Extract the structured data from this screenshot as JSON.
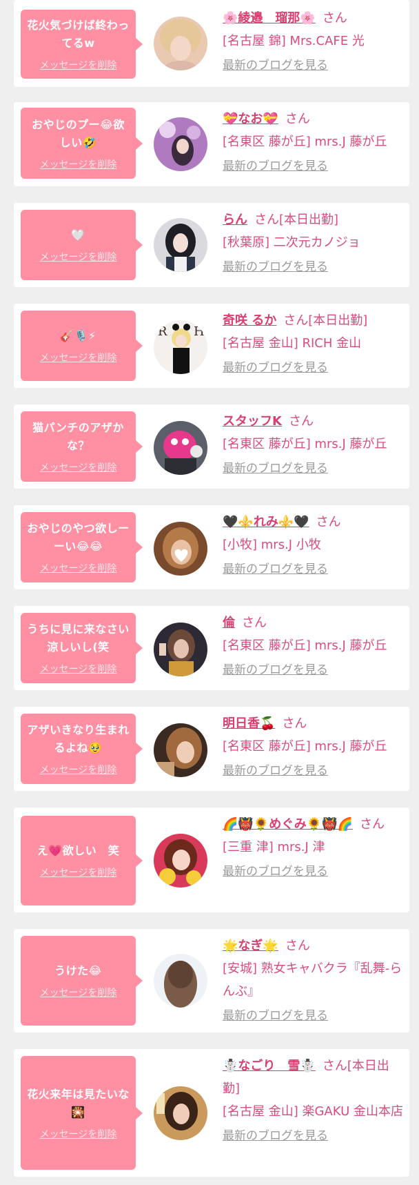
{
  "delete_label": "メッセージを削除",
  "blog_label": "最新のブログを見る",
  "colors": {
    "bubble": "#ff8fa3",
    "accent": "#d84d79",
    "link_gray": "#9a9a9a",
    "background": "#efefef"
  },
  "entries": [
    {
      "message": "花火気づけば終わってるw",
      "name": "🌸綾邉　瑠那🌸",
      "suffix": "さん",
      "status": "",
      "shop": "[名古屋 錦] Mrs.CAFE 光"
    },
    {
      "message": "おやじのプー😂欲しい🤣",
      "name": "💝なお💝",
      "suffix": "さん",
      "status": "",
      "shop": "[名東区 藤が丘] mrs.J 藤が丘"
    },
    {
      "message": "🤍",
      "name": "らん",
      "suffix": "さん",
      "status": "[本日出勤]",
      "shop": "[秋葉原] 二次元カノジョ"
    },
    {
      "message": "🎸🎙️⚡",
      "name": "奇咲 るか",
      "suffix": "さん",
      "status": "[本日出勤]",
      "shop": "[名古屋 金山] RICH 金山"
    },
    {
      "message": "猫パンチのアザかな？",
      "name": "スタッフK",
      "suffix": "さん",
      "status": "",
      "shop": "[名東区 藤が丘] mrs.J 藤が丘"
    },
    {
      "message": "おやじのやつ欲しーーい😂😂",
      "name": "🖤⚜️れみ⚜️🖤",
      "suffix": "さん",
      "status": "",
      "shop": "[小牧] mrs.J 小牧"
    },
    {
      "message": "うちに見に来なさい涼しいし(笑",
      "name": "倫",
      "suffix": "さん",
      "status": "",
      "shop": "[名東区 藤が丘] mrs.J 藤が丘"
    },
    {
      "message": "アザいきなり生まれるよね🥹",
      "name": "明日香🍒",
      "suffix": "さん",
      "status": "",
      "shop": "[名東区 藤が丘] mrs.J 藤が丘"
    },
    {
      "message": "え💗欲しい　笑",
      "name": "🌈👹🌻めぐみ🌻👹🌈",
      "suffix": "さん",
      "status": "",
      "shop": "[三重 津] mrs.J 津"
    },
    {
      "message": "うけた😂",
      "name": "🌟なぎ🌟",
      "suffix": "さん",
      "status": "",
      "shop": "[安城] 熟女キャバクラ『乱舞-らんぶ』"
    },
    {
      "message": "花火来年は見たいな🎇",
      "name": "☃️なごり　雪☃️",
      "suffix": "さん",
      "status": "[本日出勤]",
      "shop": "[名古屋 金山] 楽GAKU 金山本店"
    }
  ]
}
